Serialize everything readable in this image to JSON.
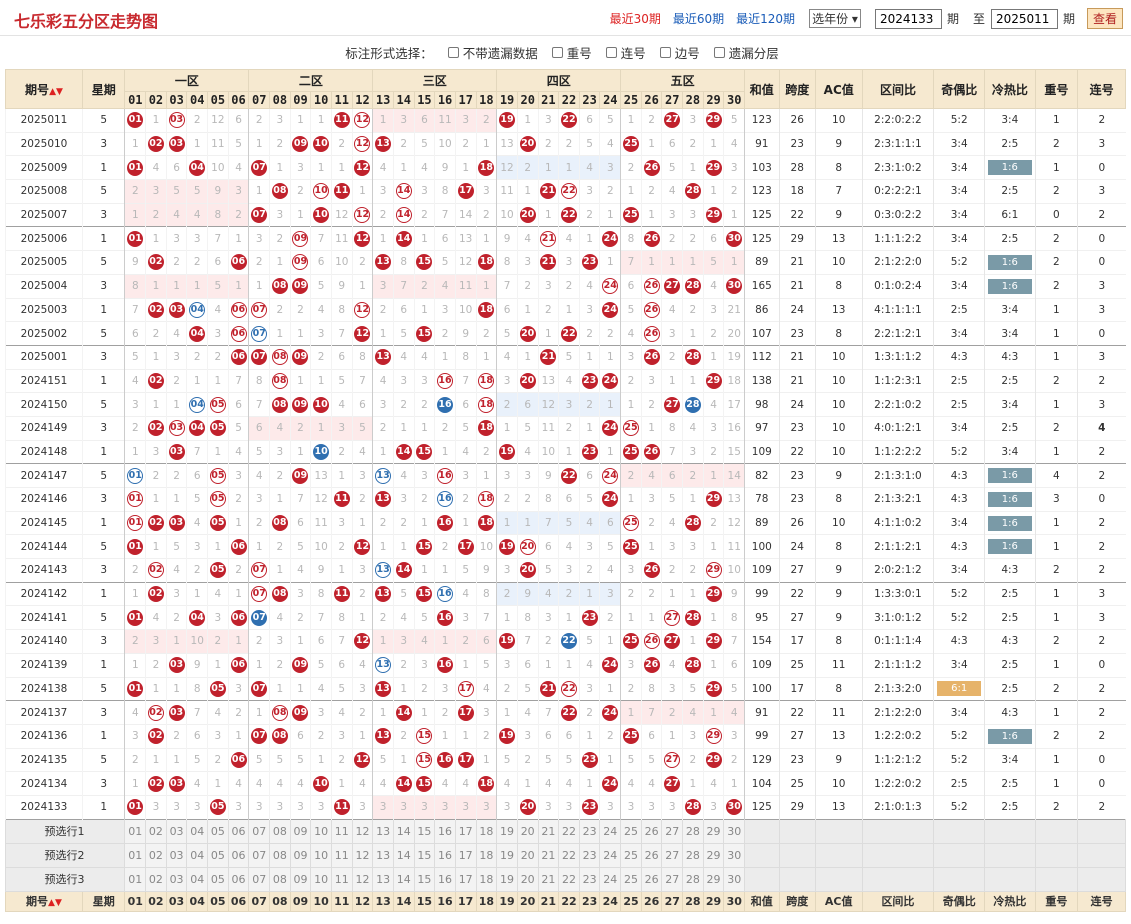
{
  "header": {
    "title": "七乐彩五分区走势图",
    "links": [
      "最近30期",
      "最近60期",
      "最近120期"
    ],
    "active": 0,
    "year_select": "选年份",
    "from": "2024133",
    "mid_label": "期",
    "to_label": "至",
    "to": "2025011",
    "end_label": "期",
    "view": "查看"
  },
  "options": {
    "label": "标注形式选择：",
    "items": [
      "不带遗漏数据",
      "重号",
      "连号",
      "边号",
      "遗漏分层"
    ]
  },
  "columns": {
    "issue": "期号",
    "week": "星期",
    "zones": [
      "一区",
      "二区",
      "三区",
      "四区",
      "五区"
    ],
    "stats": [
      "和值",
      "跨度",
      "AC值",
      "区间比",
      "奇偶比",
      "冷热比",
      "重号",
      "连号"
    ]
  },
  "rows": [
    [
      "2025011",
      "5",
      [
        1,
        3,
        11,
        12,
        19,
        22,
        27,
        29
      ],
      "123",
      "26",
      "10",
      "2:2:0:2:2",
      "5:2",
      "3:4",
      "1",
      "2"
    ],
    [
      "2025010",
      "3",
      [
        2,
        3,
        9,
        10,
        12,
        13,
        20,
        25
      ],
      "91",
      "23",
      "9",
      "2:3:1:1:1",
      "3:4",
      "2:5",
      "2",
      "3"
    ],
    [
      "2025009",
      "1",
      [
        1,
        4,
        7,
        12,
        18,
        26,
        29
      ],
      "103",
      "28",
      "8",
      "2:3:1:0:2",
      "3:4",
      "1:6",
      "1",
      "0"
    ],
    [
      "2025008",
      "5",
      [
        8,
        10,
        11,
        14,
        17,
        21,
        22,
        28
      ],
      "123",
      "18",
      "7",
      "0:2:2:2:1",
      "3:4",
      "2:5",
      "2",
      "3"
    ],
    [
      "2025007",
      "3",
      [
        7,
        10,
        12,
        14,
        20,
        22,
        25,
        29
      ],
      "125",
      "22",
      "9",
      "0:3:0:2:2",
      "3:4",
      "6:1",
      "0",
      "2"
    ],
    [
      "2025006",
      "1",
      [
        1,
        9,
        12,
        14,
        21,
        24,
        26,
        30
      ],
      "125",
      "29",
      "13",
      "1:1:1:2:2",
      "3:4",
      "2:5",
      "2",
      "0"
    ],
    [
      "2025005",
      "5",
      [
        2,
        6,
        9,
        13,
        15,
        18,
        21,
        23
      ],
      "89",
      "21",
      "10",
      "2:1:2:2:0",
      "5:2",
      "1:6",
      "2",
      "0"
    ],
    [
      "2025004",
      "3",
      [
        8,
        9,
        24,
        26,
        27,
        28,
        30
      ],
      "165",
      "21",
      "8",
      "0:1:0:2:4",
      "3:4",
      "1:6",
      "2",
      "3"
    ],
    [
      "2025003",
      "1",
      [
        2,
        3,
        4,
        6,
        7,
        12,
        18,
        24,
        26
      ],
      "86",
      "24",
      "13",
      "4:1:1:1:1",
      "2:5",
      "3:4",
      "1",
      "3"
    ],
    [
      "2025002",
      "5",
      [
        4,
        6,
        7,
        12,
        15,
        20,
        22,
        26
      ],
      "107",
      "23",
      "8",
      "2:2:1:2:1",
      "3:4",
      "3:4",
      "1",
      "0"
    ],
    [
      "2025001",
      "3",
      [
        6,
        7,
        8,
        9,
        13,
        21,
        26,
        28
      ],
      "112",
      "21",
      "10",
      "1:3:1:1:2",
      "4:3",
      "4:3",
      "1",
      "3"
    ],
    [
      "2024151",
      "1",
      [
        2,
        8,
        16,
        18,
        20,
        23,
        24,
        29
      ],
      "138",
      "21",
      "10",
      "1:1:2:3:1",
      "2:5",
      "2:5",
      "2",
      "2"
    ],
    [
      "2024150",
      "5",
      [
        4,
        5,
        8,
        9,
        10,
        16,
        18,
        27,
        28
      ],
      "98",
      "24",
      "10",
      "2:2:1:0:2",
      "2:5",
      "3:4",
      "1",
      "3"
    ],
    [
      "2024149",
      "3",
      [
        2,
        3,
        4,
        5,
        18,
        24,
        25
      ],
      "97",
      "23",
      "10",
      "4:0:1:2:1",
      "3:4",
      "2:5",
      "2",
      "4"
    ],
    [
      "2024148",
      "1",
      [
        3,
        10,
        14,
        15,
        19,
        23,
        25,
        26
      ],
      "109",
      "22",
      "10",
      "1:1:2:2:2",
      "5:2",
      "3:4",
      "1",
      "2"
    ],
    [
      "2024147",
      "5",
      [
        1,
        5,
        9,
        13,
        16,
        22,
        24
      ],
      "82",
      "23",
      "9",
      "2:1:3:1:0",
      "4:3",
      "1:6",
      "4",
      "2"
    ],
    [
      "2024146",
      "3",
      [
        1,
        5,
        11,
        13,
        16,
        18,
        24,
        29
      ],
      "78",
      "23",
      "8",
      "2:1:3:2:1",
      "4:3",
      "1:6",
      "3",
      "0"
    ],
    [
      "2024145",
      "1",
      [
        1,
        2,
        3,
        5,
        8,
        16,
        18,
        25,
        28
      ],
      "89",
      "26",
      "10",
      "4:1:1:0:2",
      "3:4",
      "1:6",
      "1",
      "2"
    ],
    [
      "2024144",
      "5",
      [
        1,
        6,
        12,
        15,
        17,
        19,
        20,
        25
      ],
      "100",
      "24",
      "8",
      "2:1:1:2:1",
      "4:3",
      "1:6",
      "1",
      "2"
    ],
    [
      "2024143",
      "3",
      [
        2,
        5,
        7,
        13,
        14,
        20,
        26,
        29
      ],
      "109",
      "27",
      "9",
      "2:0:2:1:2",
      "3:4",
      "4:3",
      "2",
      "2"
    ],
    [
      "2024142",
      "1",
      [
        2,
        7,
        8,
        11,
        13,
        15,
        16,
        29
      ],
      "99",
      "22",
      "9",
      "1:3:3:0:1",
      "5:2",
      "2:5",
      "1",
      "3"
    ],
    [
      "2024141",
      "5",
      [
        1,
        4,
        6,
        7,
        16,
        23,
        27,
        28
      ],
      "95",
      "27",
      "9",
      "3:1:0:1:2",
      "5:2",
      "2:5",
      "1",
      "3"
    ],
    [
      "2024140",
      "3",
      [
        12,
        19,
        22,
        25,
        26,
        27,
        29
      ],
      "154",
      "17",
      "8",
      "0:1:1:1:4",
      "4:3",
      "4:3",
      "2",
      "2"
    ],
    [
      "2024139",
      "1",
      [
        3,
        6,
        9,
        13,
        16,
        24,
        26,
        28
      ],
      "109",
      "25",
      "11",
      "2:1:1:1:2",
      "3:4",
      "2:5",
      "1",
      "0"
    ],
    [
      "2024138",
      "5",
      [
        1,
        5,
        7,
        13,
        17,
        21,
        22,
        29
      ],
      "100",
      "17",
      "8",
      "2:1:3:2:0",
      "6:1",
      "2:5",
      "2",
      "2"
    ],
    [
      "2024137",
      "3",
      [
        2,
        3,
        8,
        9,
        14,
        17,
        22,
        24
      ],
      "91",
      "22",
      "11",
      "2:1:2:2:0",
      "3:4",
      "4:3",
      "1",
      "2"
    ],
    [
      "2024136",
      "1",
      [
        2,
        7,
        8,
        13,
        15,
        19,
        25,
        29
      ],
      "99",
      "27",
      "13",
      "1:2:2:0:2",
      "5:2",
      "1:6",
      "2",
      "2"
    ],
    [
      "2024135",
      "5",
      [
        6,
        12,
        15,
        16,
        17,
        23,
        27,
        29
      ],
      "129",
      "23",
      "9",
      "1:1:2:1:2",
      "5:2",
      "3:4",
      "1",
      "0"
    ],
    [
      "2024134",
      "3",
      [
        2,
        3,
        10,
        14,
        15,
        18,
        24,
        27
      ],
      "104",
      "25",
      "10",
      "1:2:2:0:2",
      "2:5",
      "2:5",
      "1",
      "0"
    ],
    [
      "2024133",
      "1",
      [
        1,
        5,
        11,
        20,
        23,
        28,
        30
      ],
      "125",
      "29",
      "13",
      "2:1:0:1:3",
      "5:2",
      "2:5",
      "2",
      "2"
    ]
  ],
  "preselect": [
    "预选行1",
    "预选行2",
    "预选行3"
  ]
}
